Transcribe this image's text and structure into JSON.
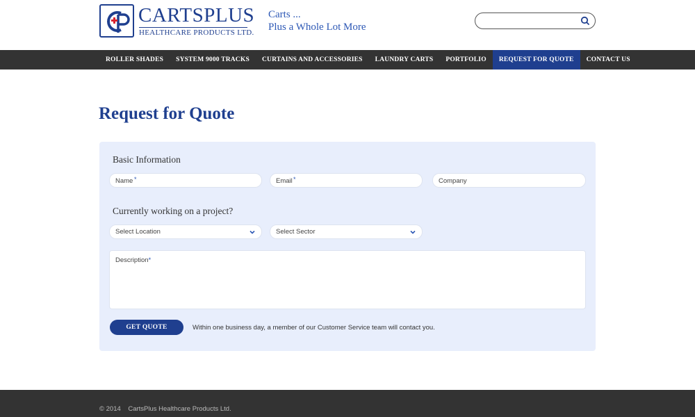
{
  "brand": {
    "name": "CARTSPLUS",
    "subtitle": "HEALTHCARE PRODUCTS LTD.",
    "tagline_line1": "Carts ...",
    "tagline_line2": "Plus a Whole Lot More",
    "primary_color": "#1f3f8f",
    "accent_color": "#d9232e"
  },
  "search": {
    "value": "",
    "placeholder": "",
    "icon": "search-icon"
  },
  "nav": {
    "items": [
      {
        "label": "ROLLER SHADES",
        "active": false
      },
      {
        "label": "SYSTEM 9000 TRACKS",
        "active": false
      },
      {
        "label": "CURTAINS AND ACCESSORIES",
        "active": false
      },
      {
        "label": "LAUNDRY CARTS",
        "active": false
      },
      {
        "label": "PORTFOLIO",
        "active": false
      },
      {
        "label": "REQUEST FOR QUOTE",
        "active": true
      },
      {
        "label": "CONTACT US",
        "active": false
      }
    ]
  },
  "page": {
    "title": "Request for Quote"
  },
  "form": {
    "basic_heading": "Basic Information",
    "name_placeholder": "Name",
    "email_placeholder": "Email",
    "company_placeholder": "Company",
    "required_mark": "*",
    "project_heading": "Currently working on a project?",
    "location_selected": "Select Location",
    "sector_selected": "Select Sector",
    "description_label": "Description",
    "submit_label": "GET QUOTE",
    "notice": "Within one business day, a member of our Customer Service team will contact you."
  },
  "footer": {
    "copyright": "© 2014    CartsPlus Healthcare Products Ltd."
  }
}
